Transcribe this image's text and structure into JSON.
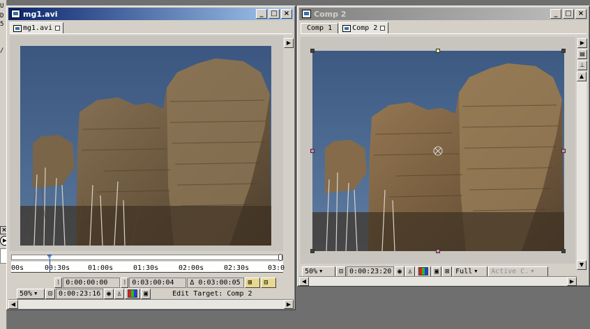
{
  "left_strip": {
    "chars": [
      "U",
      "D",
      "5",
      "/"
    ]
  },
  "footage_window": {
    "title": "mg1.avi",
    "tab_label": "mg1.avi",
    "ruler_labels": [
      "00s",
      "00:30s",
      "01:00s",
      "01:30s",
      "02:00s",
      "02:30s",
      "03:0"
    ],
    "current_position": 0.14,
    "in_point": "0:00:00:00",
    "out_point": "0:03:00:04",
    "duration": "Δ 0:03:00:05",
    "zoom": "50%",
    "timecode": "0:00:23:16",
    "edit_target": "Edit Target: Comp 2"
  },
  "comp_window": {
    "title": "Comp 2",
    "tabs": [
      "Comp 1",
      "Comp 2"
    ],
    "zoom": "50%",
    "timecode": "0:00:23:20",
    "resolution": "Full",
    "camera": "Active C."
  },
  "colors": {
    "title_active": "#0a246a",
    "title_inactive": "#808080",
    "sky": "#3e5c84",
    "rock": "#7a6548"
  },
  "icons": [
    "close-icon",
    "minimize-icon",
    "maximize-icon",
    "play-icon",
    "menu-arrow-icon",
    "camera-icon",
    "channel-icon",
    "grid-icon",
    "target-icon",
    "transparency-icon"
  ]
}
